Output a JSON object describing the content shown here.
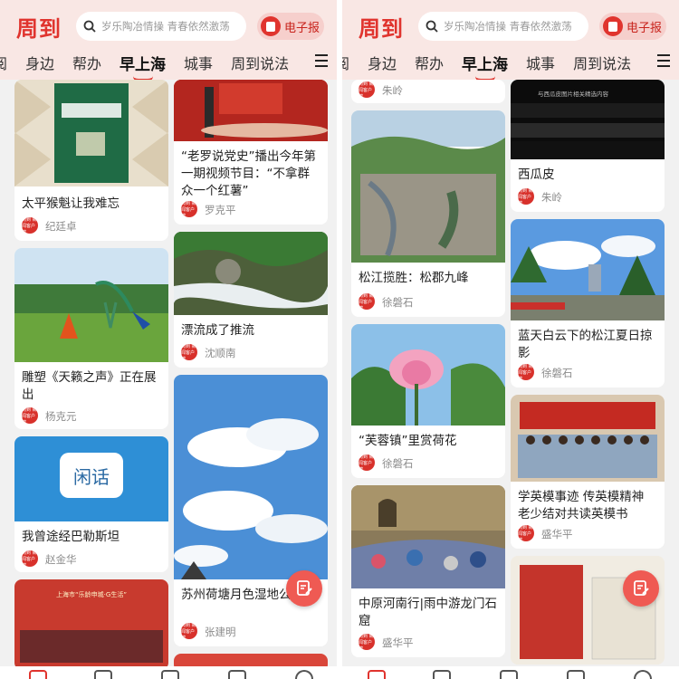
{
  "app": {
    "logo": "周到",
    "search_placeholder": "岁乐陶冶情操 青春依然激荡",
    "epaper_label": "电子报",
    "colors": {
      "brand": "#e0342e",
      "header_bg": "#f9e7e4"
    }
  },
  "nav": {
    "items": [
      "阅",
      "身边",
      "帮办",
      "早上海",
      "城事",
      "周到说法"
    ],
    "active": "早上海"
  },
  "left_feed": {
    "col1": [
      {
        "title": "太平猴魁让我难忘",
        "author": "纪廷卓"
      },
      {
        "title": "雕塑《天籁之声》正在展出",
        "author": "杨克元"
      },
      {
        "title": "我曾途经巴勒斯坦",
        "author": "赵金华",
        "image_text": "闲话"
      },
      {
        "title": "",
        "author": "",
        "image_text": "上海市“乐龄申城·G生活”"
      }
    ],
    "col2": [
      {
        "title": "“老罗说党史”播出今年第一期视频节目：“不拿群众一个红薯”",
        "author": "罗克平"
      },
      {
        "title": "漂流成了推流",
        "author": "沈顺南"
      },
      {
        "title": "苏州荷塘月色湿地公园记",
        "author": "张建明"
      }
    ]
  },
  "right_feed": {
    "col1": [
      {
        "title": "",
        "author": "朱岭"
      },
      {
        "title": "松江揽胜：松郡九峰",
        "author": "徐磐石"
      },
      {
        "title": "“芙蓉镇”里赏荷花",
        "author": "徐磐石"
      },
      {
        "title": "中原河南行|雨中游龙门石窟",
        "author": "盛华平"
      }
    ],
    "col2": [
      {
        "title": "西瓜皮",
        "author": "朱岭",
        "image_text": "与西瓜皮图片相关精选内容"
      },
      {
        "title": "蓝天白云下的松江夏日掠影",
        "author": "徐磐石"
      },
      {
        "title": "学英模事迹 传英模精神 老少结对共读英模书",
        "author": "盛华平"
      },
      {
        "title": "",
        "author": ""
      }
    ]
  },
  "avatar_text": "周到 新闻客户端"
}
